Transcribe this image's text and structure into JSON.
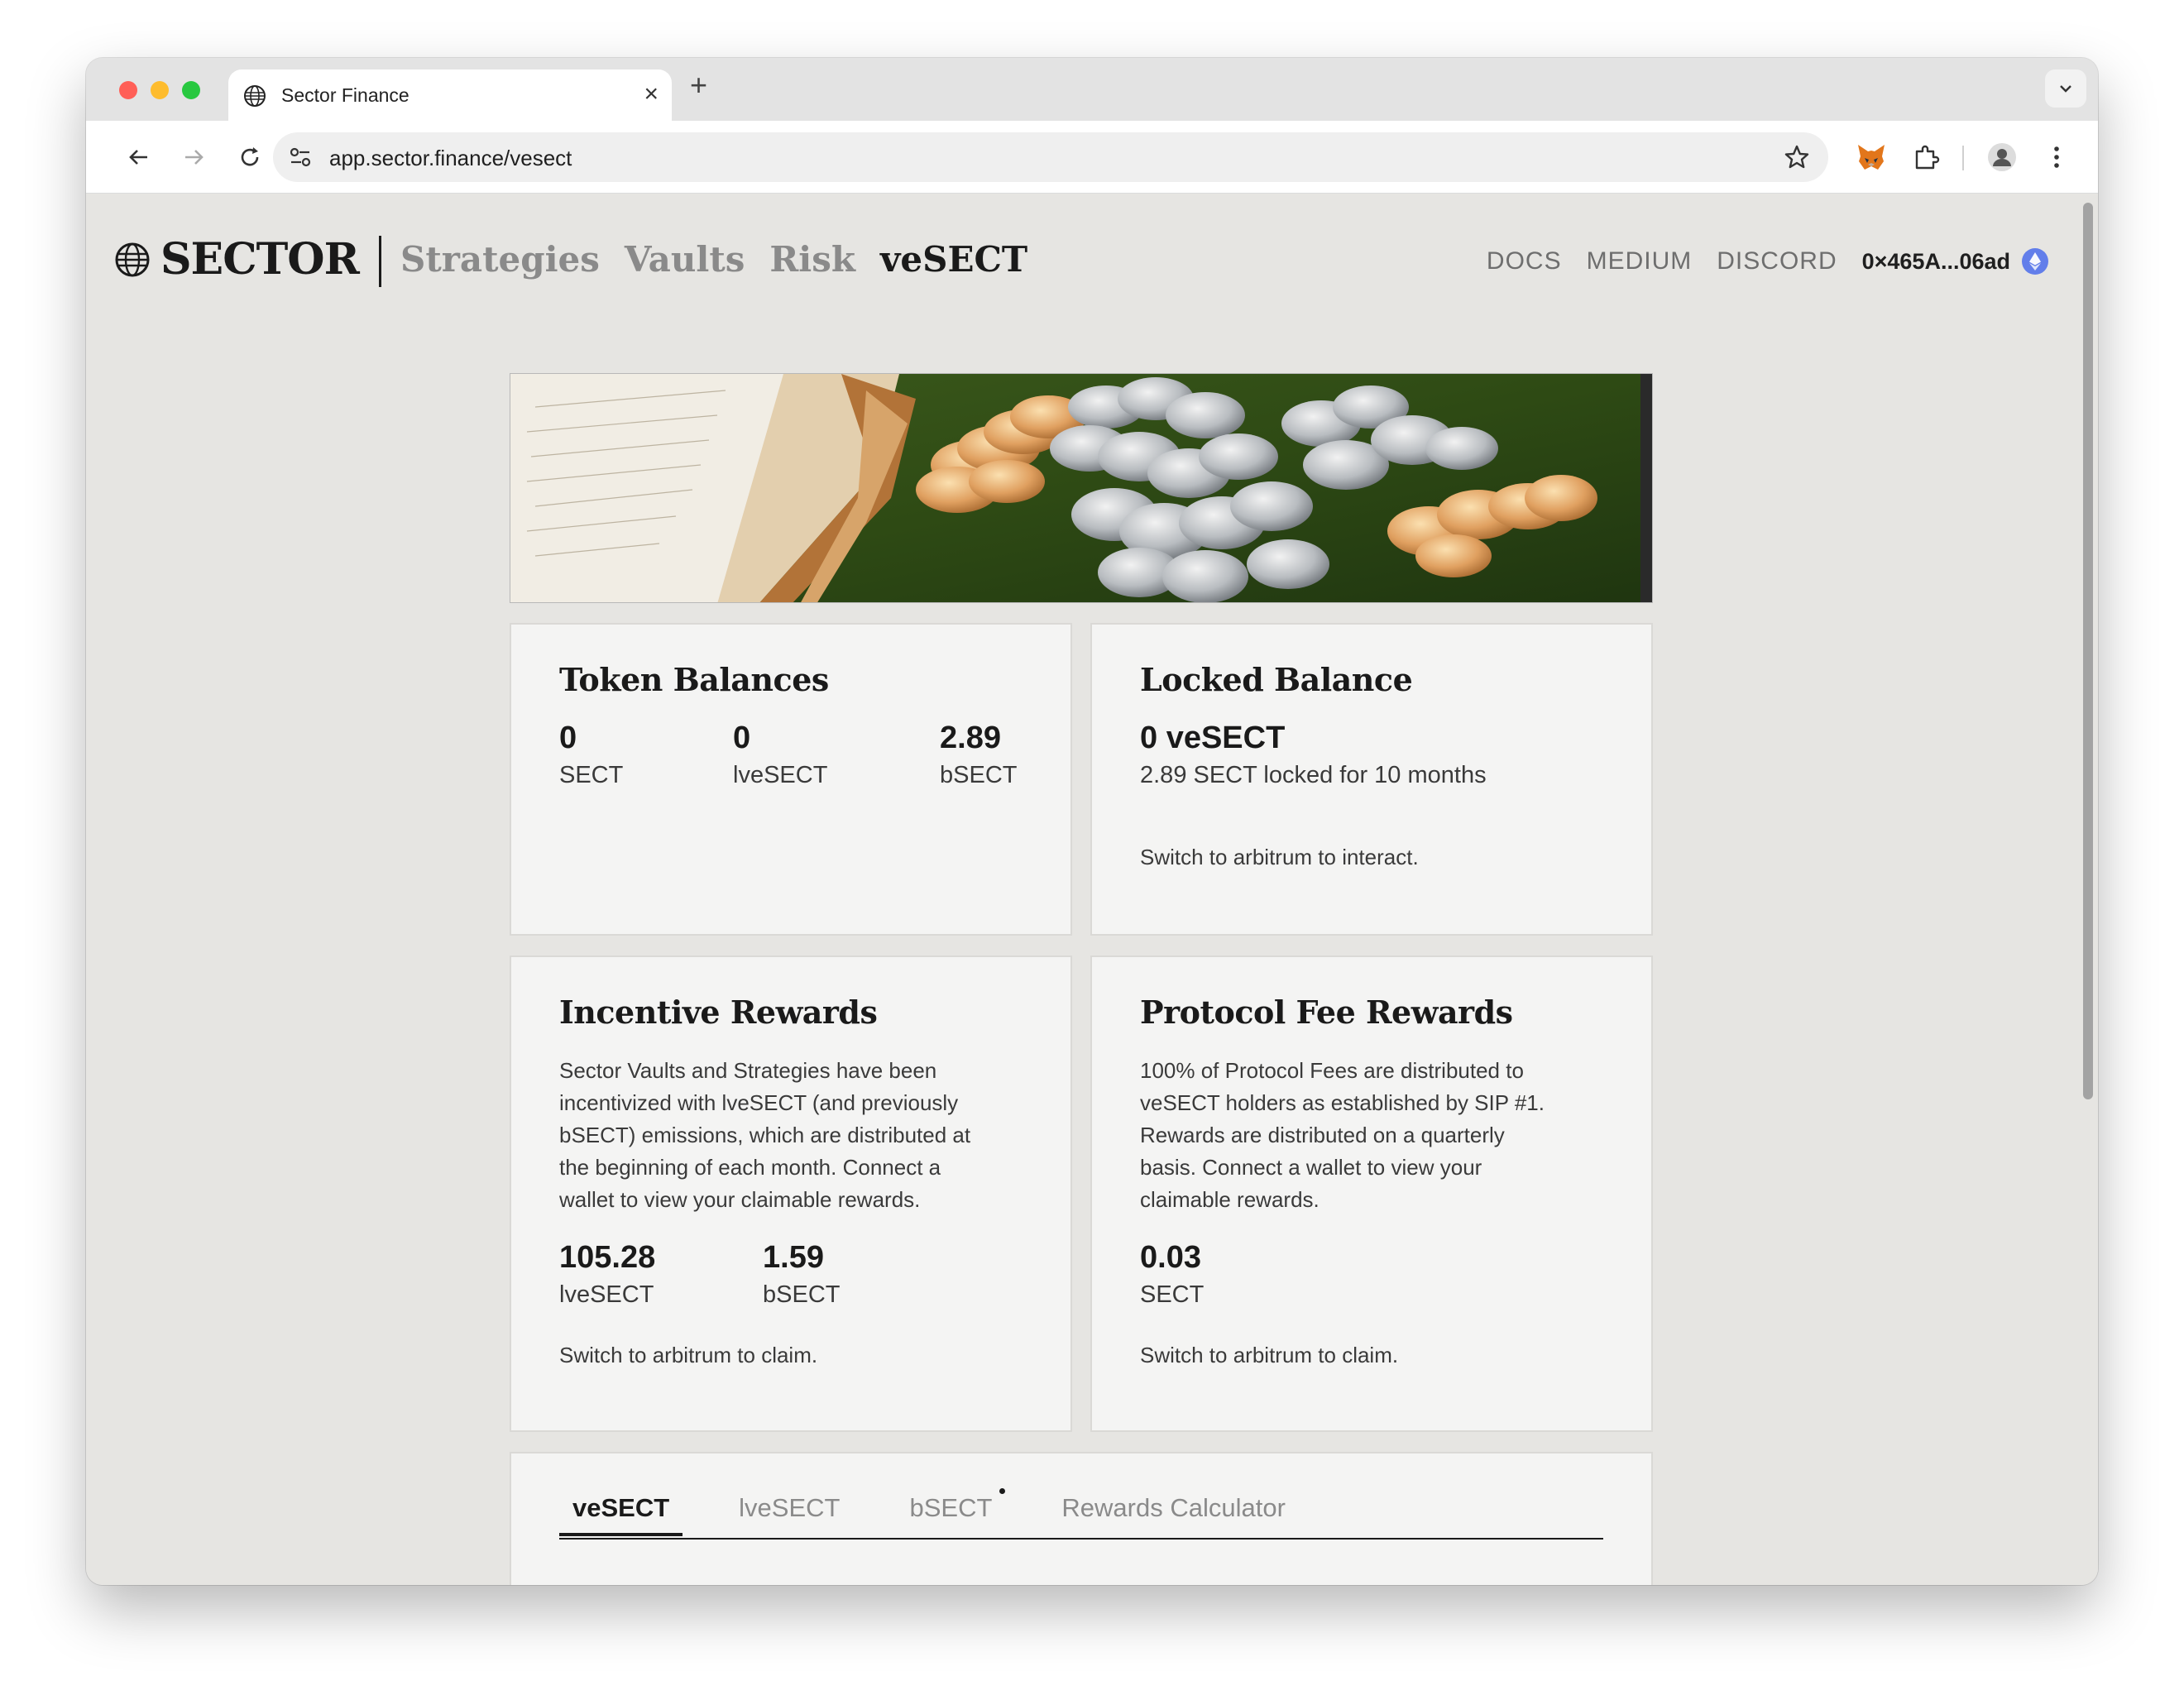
{
  "browser": {
    "tab_title": "Sector Finance",
    "url": "app.sector.finance/vesect"
  },
  "site": {
    "logo": "SECTOR",
    "nav": [
      "Strategies",
      "Vaults",
      "Risk",
      "veSECT"
    ],
    "links": [
      "DOCS",
      "MEDIUM",
      "DISCORD"
    ],
    "wallet": "0×465A...06ad"
  },
  "token_balances": {
    "title": "Token Balances",
    "items": [
      {
        "value": "0",
        "label": "SECT"
      },
      {
        "value": "0",
        "label": "lveSECT"
      },
      {
        "value": "2.89",
        "label": "bSECT"
      }
    ]
  },
  "locked_balance": {
    "title": "Locked Balance",
    "value": "0 veSECT",
    "detail": "2.89 SECT locked for 10 months",
    "note": "Switch to arbitrum to interact."
  },
  "incentive_rewards": {
    "title": "Incentive Rewards",
    "desc_lines": [
      "Sector Vaults and Strategies have been",
      "incentivized with lveSECT (and previously",
      "bSECT) emissions, which are distributed at",
      "the beginning of each month. Connect a",
      "wallet to view your claimable rewards."
    ],
    "items": [
      {
        "value": "105.28",
        "label": "lveSECT"
      },
      {
        "value": "1.59",
        "label": "bSECT"
      }
    ],
    "note": "Switch to arbitrum to claim."
  },
  "protocol_fee_rewards": {
    "title": "Protocol Fee Rewards",
    "desc_lines": [
      "100% of Protocol Fees are distributed to",
      "veSECT holders as established by SIP #1.",
      "Rewards are distributed on a quarterly",
      "basis. Connect a wallet to view your",
      "claimable rewards."
    ],
    "items": [
      {
        "value": "0.03",
        "label": "SECT"
      }
    ],
    "note": "Switch to arbitrum to claim."
  },
  "bottom_tabs": [
    "veSECT",
    "lveSECT",
    "bSECT",
    "Rewards Calculator"
  ],
  "colors": {
    "page_bg": "#e6e5e2",
    "card_bg": "#f4f4f3",
    "text": "#1a1a1a",
    "muted": "#8a8a8a",
    "eth_badge": "#627eea"
  }
}
